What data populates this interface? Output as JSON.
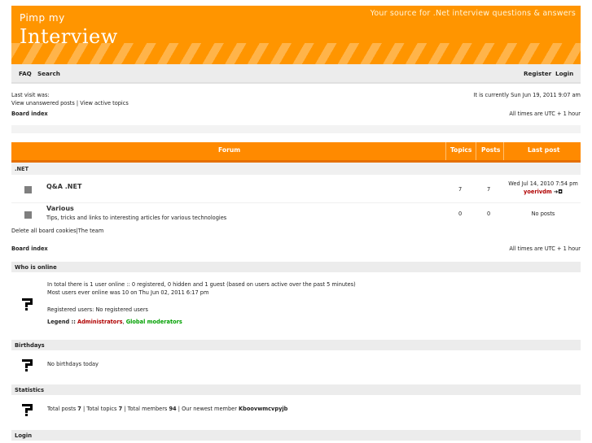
{
  "header": {
    "logo_small": "Pimp my",
    "logo_big": "Interview",
    "tagline": "Your source for .Net interview questions & answers"
  },
  "nav": {
    "faq": "FAQ",
    "search": "Search",
    "register": "Register",
    "login": "Login"
  },
  "info": {
    "last_visit": "Last visit was:",
    "current_time": "It is currently Sun Jun 19, 2011 9:07 am",
    "unanswered": "View unanswered posts",
    "divider": "|",
    "active": "View active topics",
    "board_index": "Board index",
    "timezone": "All times are UTC + 1 hour"
  },
  "table": {
    "headers": {
      "forum": "Forum",
      "topics": "Topics",
      "posts": "Posts",
      "last_post": "Last post"
    },
    "category": ".NET",
    "rows": [
      {
        "name": "Q&A .NET",
        "desc": "",
        "topics": "7",
        "posts": "7",
        "last_date": "Wed Jul 14, 2010 7:54 pm",
        "last_user": "yoerivdm",
        "last_icon": "➔◘"
      },
      {
        "name": "Various",
        "desc": "Tips, tricks and links to interesting articles for various technologies",
        "topics": "0",
        "posts": "0",
        "last_date": "No posts",
        "last_user": "",
        "last_icon": ""
      }
    ]
  },
  "footer_links": {
    "delete_cookies": "Delete all board cookies",
    "divider": "|",
    "team": "The team"
  },
  "board_index_2": "Board index",
  "timezone_2": "All times are UTC + 1 hour",
  "who_online": {
    "title": "Who is online",
    "line1": "In total there is 1 user online :: 0 registered, 0 hidden and 1 guest (based on users active over the past 5 minutes)",
    "line2": "Most users ever online was 10 on Thu Jun 02, 2011 6:17 pm",
    "registered": "Registered users: No registered users",
    "legend_label": "Legend ::",
    "admins": "Administrators",
    "comma": ",",
    "global_mods": "Global moderators"
  },
  "birthdays": {
    "title": "Birthdays",
    "text": "No birthdays today"
  },
  "statistics": {
    "title": "Statistics",
    "text_a": "Total posts ",
    "posts": "7",
    "text_b": " | Total topics ",
    "topics": "7",
    "text_c": " | Total members ",
    "members": "94",
    "text_d": " | Our newest member ",
    "newest": "Kboovwmcvpyjb"
  },
  "login": {
    "title": "Login"
  },
  "colors": {
    "orange": "#ff8a00",
    "admin": "#b00000",
    "gmod": "#00a000"
  },
  "icons": {
    "forum": "forum-read-icon",
    "stats": "stats-icon"
  }
}
